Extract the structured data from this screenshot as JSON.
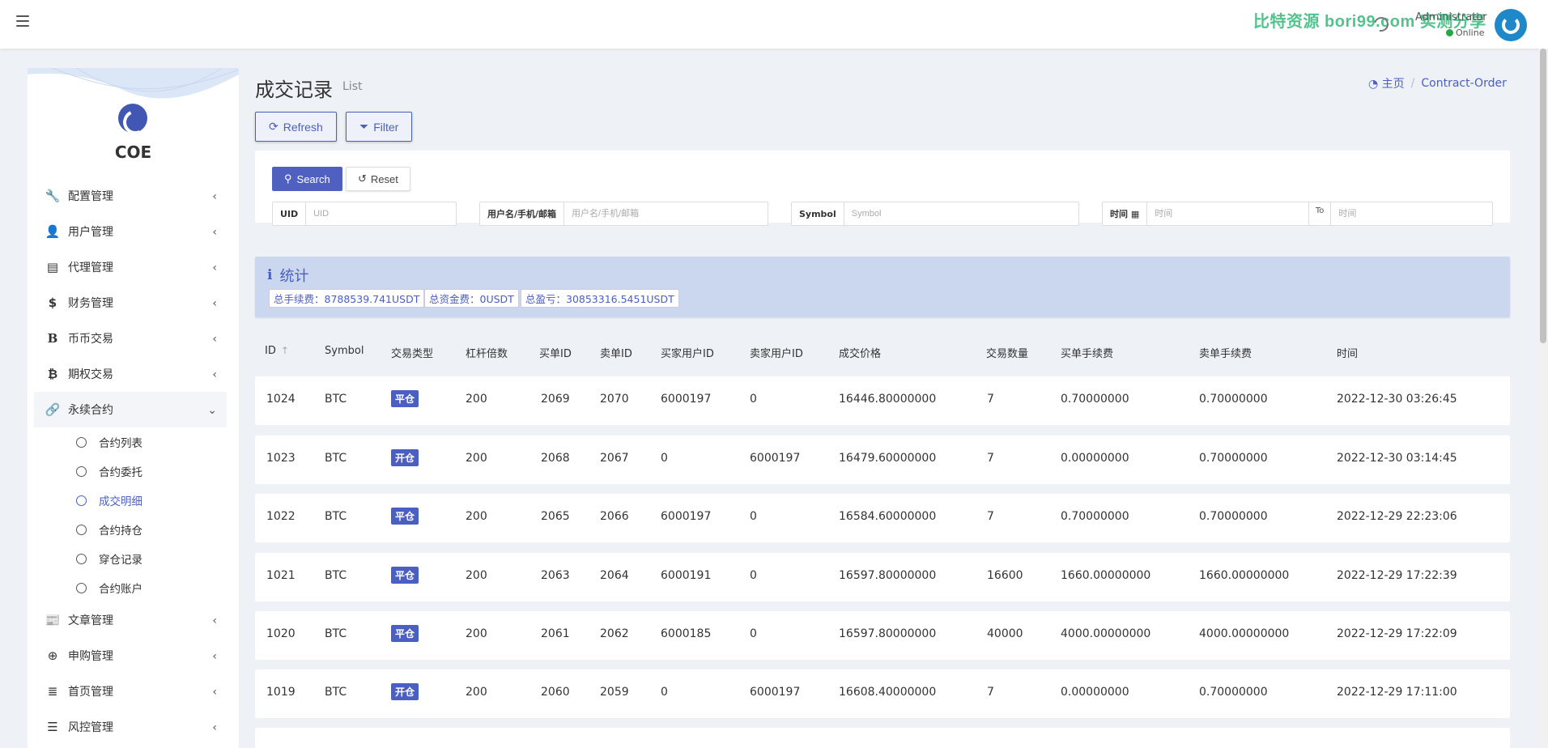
{
  "topbar": {
    "watermark": "比特资源 bori99.com 实测分享",
    "user_name": "Administrator",
    "user_status": "Online"
  },
  "sidebar": {
    "logo_text": "COE",
    "items": [
      {
        "label": "配置管理",
        "icon": "wrench-icon"
      },
      {
        "label": "用户管理",
        "icon": "user-icon"
      },
      {
        "label": "代理管理",
        "icon": "id-card-icon"
      },
      {
        "label": "财务管理",
        "icon": "dollar-icon"
      },
      {
        "label": "币币交易",
        "icon": "bold-b-icon"
      },
      {
        "label": "期权交易",
        "icon": "bitcoin-icon"
      },
      {
        "label": "永续合约",
        "icon": "link-icon"
      },
      {
        "label": "文章管理",
        "icon": "newspaper-icon"
      },
      {
        "label": "申购管理",
        "icon": "lifebuoy-icon"
      },
      {
        "label": "首页管理",
        "icon": "list-icon"
      },
      {
        "label": "风控管理",
        "icon": "indent-icon"
      }
    ],
    "sub_items": [
      "合约列表",
      "合约委托",
      "成交明细",
      "合约持仓",
      "穿仓记录",
      "合约账户"
    ],
    "active_sub": "成交明细"
  },
  "header": {
    "title": "成交记录",
    "subtitle": "List",
    "breadcrumb_home": "主页",
    "breadcrumb_current": "Contract-Order"
  },
  "toolbar": {
    "refresh_label": "Refresh",
    "filter_label": "Filter"
  },
  "filters": {
    "search_label": "Search",
    "reset_label": "Reset",
    "uid_label": "UID",
    "uid_placeholder": "UID",
    "user_label": "用户名/手机/邮箱",
    "user_placeholder": "用户名/手机/邮箱",
    "symbol_label": "Symbol",
    "symbol_placeholder": "Symbol",
    "time_label": "时间",
    "time_from_placeholder": "时间",
    "time_to_label": "To",
    "time_to_placeholder": "时间"
  },
  "stats": {
    "title": "统计",
    "fee": "总手续费：8788539.741USDT",
    "fund": "总资金费：0USDT",
    "pnl": "总盈亏：30853316.5451USDT"
  },
  "table": {
    "columns": [
      "ID",
      "Symbol",
      "交易类型",
      "杠杆倍数",
      "买单ID",
      "卖单ID",
      "买家用户ID",
      "卖家用户ID",
      "成交价格",
      "交易数量",
      "买单手续费",
      "卖单手续费",
      "时间"
    ],
    "rows": [
      [
        "1024",
        "BTC",
        "平仓",
        "200",
        "2069",
        "2070",
        "6000197",
        "0",
        "16446.80000000",
        "7",
        "0.70000000",
        "0.70000000",
        "2022-12-30 03:26:45"
      ],
      [
        "1023",
        "BTC",
        "开仓",
        "200",
        "2068",
        "2067",
        "0",
        "6000197",
        "16479.60000000",
        "7",
        "0.00000000",
        "0.70000000",
        "2022-12-30 03:14:45"
      ],
      [
        "1022",
        "BTC",
        "平仓",
        "200",
        "2065",
        "2066",
        "6000197",
        "0",
        "16584.60000000",
        "7",
        "0.70000000",
        "0.70000000",
        "2022-12-29 22:23:06"
      ],
      [
        "1021",
        "BTC",
        "平仓",
        "200",
        "2063",
        "2064",
        "6000191",
        "0",
        "16597.80000000",
        "16600",
        "1660.00000000",
        "1660.00000000",
        "2022-12-29 17:22:39"
      ],
      [
        "1020",
        "BTC",
        "平仓",
        "200",
        "2061",
        "2062",
        "6000185",
        "0",
        "16597.80000000",
        "40000",
        "4000.00000000",
        "4000.00000000",
        "2022-12-29 17:22:09"
      ],
      [
        "1019",
        "BTC",
        "开仓",
        "200",
        "2060",
        "2059",
        "0",
        "6000197",
        "16608.40000000",
        "7",
        "0.00000000",
        "0.70000000",
        "2022-12-29 17:11:00"
      ]
    ]
  },
  "colors": {
    "accent": "#4a5fc1",
    "stats_bg": "#cbd7ef",
    "online": "#28a745",
    "watermark": "#35b97a"
  }
}
